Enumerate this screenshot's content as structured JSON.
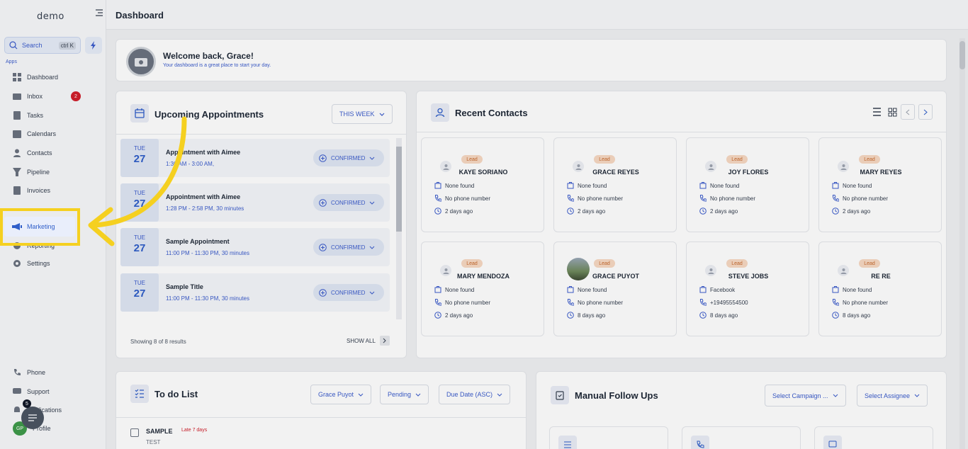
{
  "sidebar": {
    "logo": "demo",
    "search_label": "Search",
    "search_shortcut": "ctrl K",
    "apps_label": "Apps",
    "items": [
      {
        "label": "Dashboard",
        "icon": "dashboard-icon"
      },
      {
        "label": "Inbox",
        "icon": "inbox-icon",
        "badge": "2"
      },
      {
        "label": "Tasks",
        "icon": "tasks-icon"
      },
      {
        "label": "Calendars",
        "icon": "calendar-icon"
      },
      {
        "label": "Contacts",
        "icon": "contacts-icon"
      },
      {
        "label": "Pipeline",
        "icon": "pipeline-icon"
      },
      {
        "label": "Invoices",
        "icon": "invoices-icon"
      },
      {
        "label": "Marketing",
        "icon": "megaphone-icon"
      },
      {
        "label": "Reporting",
        "icon": "reporting-icon"
      },
      {
        "label": "Settings",
        "icon": "settings-icon"
      }
    ],
    "bottom_items": [
      {
        "label": "Phone",
        "icon": "phone-icon"
      },
      {
        "label": "Support",
        "icon": "support-icon"
      },
      {
        "label": "Notifications",
        "icon": "bell-icon",
        "badge": "5"
      },
      {
        "label": "Profile",
        "icon": "avatar",
        "initials": "GP"
      }
    ]
  },
  "header": {
    "title": "Dashboard"
  },
  "welcome": {
    "title": "Welcome back, Grace!",
    "subtitle": "Your dashboard is a great place to start your day."
  },
  "appointments": {
    "title": "Upcoming Appointments",
    "filter": "THIS WEEK",
    "items": [
      {
        "day": "TUE",
        "date": "27",
        "title": "Appointment with Aimee",
        "time": "1:30 AM - 3:00 AM,",
        "status": "CONFIRMED"
      },
      {
        "day": "TUE",
        "date": "27",
        "title": "Appointment with Aimee",
        "time": "1:28 PM - 2:58 PM, 30 minutes",
        "status": "CONFIRMED"
      },
      {
        "day": "TUE",
        "date": "27",
        "title": "Sample Appointment",
        "time": "11:00 PM - 11:30 PM, 30 minutes",
        "status": "CONFIRMED"
      },
      {
        "day": "TUE",
        "date": "27",
        "title": "Sample Title",
        "time": "11:00 PM - 11:30 PM, 30 minutes",
        "status": "CONFIRMED"
      }
    ],
    "footer": "Showing 8 of 8 results",
    "show_all": "SHOW ALL"
  },
  "contacts": {
    "title": "Recent Contacts",
    "items": [
      {
        "tag": "Lead",
        "name": "KAYE SORIANO",
        "company": "None found",
        "phone": "No phone number",
        "time": "2 days ago"
      },
      {
        "tag": "Lead",
        "name": "GRACE REYES",
        "company": "None found",
        "phone": "No phone number",
        "time": "2 days ago"
      },
      {
        "tag": "Lead",
        "name": "JOY FLORES",
        "company": "None found",
        "phone": "No phone number",
        "time": "2 days ago"
      },
      {
        "tag": "Lead",
        "name": "MARY REYES",
        "company": "None found",
        "phone": "No phone number",
        "time": "2 days ago"
      },
      {
        "tag": "Lead",
        "name": "MARY MENDOZA",
        "company": "None found",
        "phone": "No phone number",
        "time": "2 days ago"
      },
      {
        "tag": "Lead",
        "name": "GRACE PUYOT",
        "company": "None found",
        "phone": "No phone number",
        "time": "8 days ago"
      },
      {
        "tag": "Lead",
        "name": "STEVE JOBS",
        "company": "Facebook",
        "phone": "+19495554500",
        "time": "8 days ago"
      },
      {
        "tag": "Lead",
        "name": "RE RE",
        "company": "None found",
        "phone": "No phone number",
        "time": "8 days ago"
      }
    ]
  },
  "todo": {
    "title": "To do List",
    "filters": [
      "Grace Puyot",
      "Pending",
      "Due Date (ASC)"
    ],
    "items": [
      {
        "title": "SAMPLE",
        "due": "Late 7 days",
        "subtitle": "TEST"
      }
    ]
  },
  "followups": {
    "title": "Manual Follow Ups",
    "filters": [
      "Select Campaign ...",
      "Select Assignee"
    ]
  },
  "colors": {
    "accent": "#2f5ec9",
    "highlight": "#f5d020",
    "badge": "#d11f2b",
    "lead": "#c66a2f"
  }
}
